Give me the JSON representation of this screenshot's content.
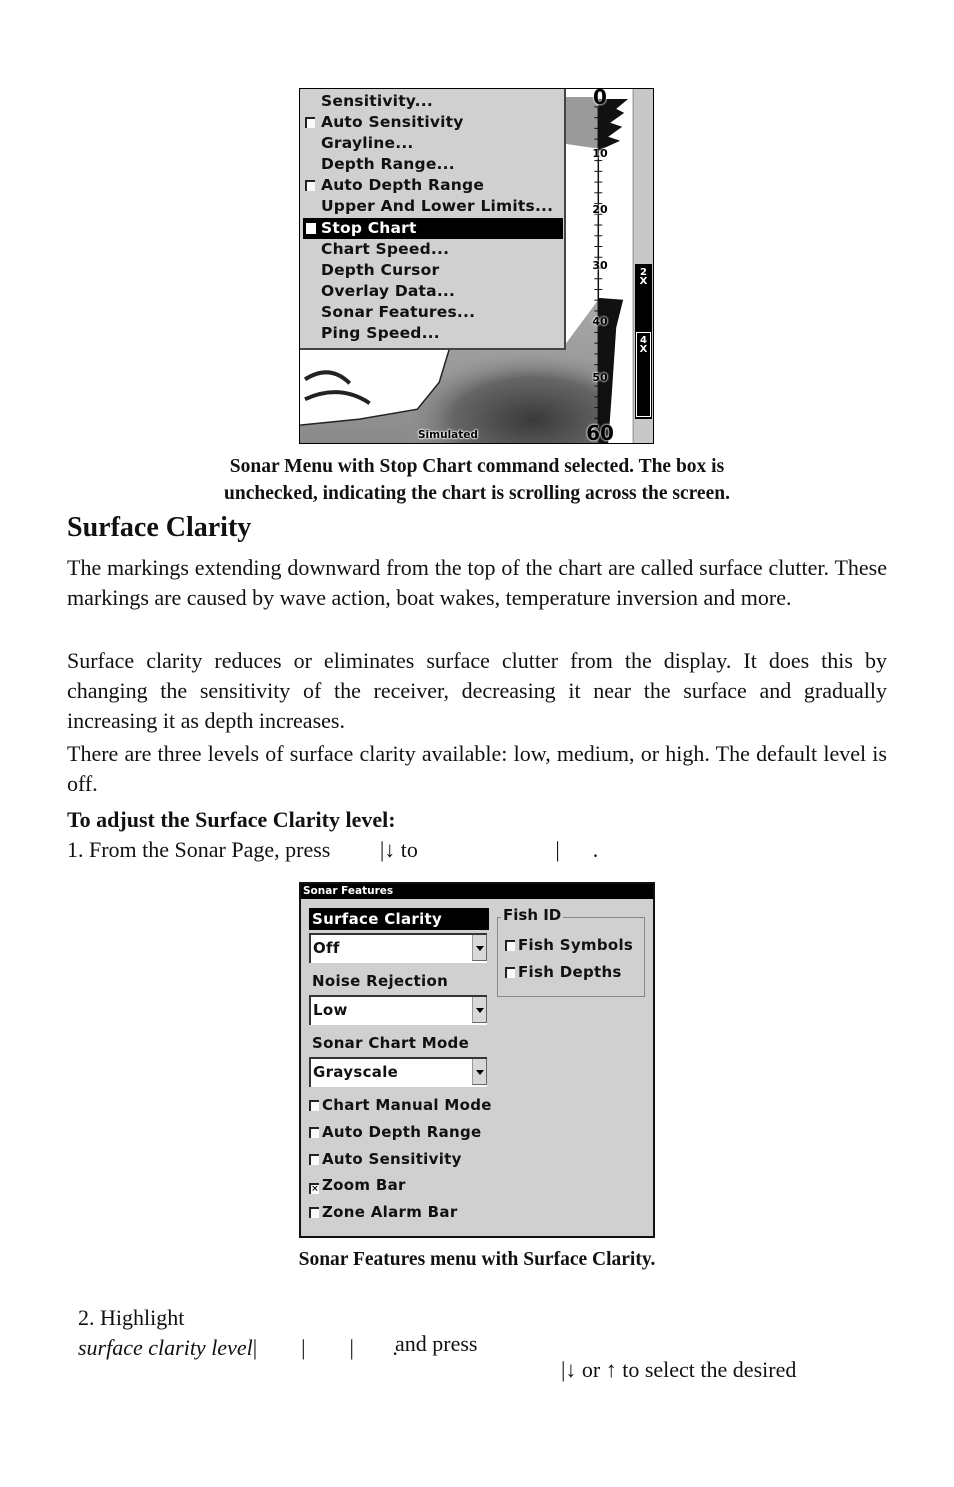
{
  "sonar_menu_screen": {
    "menu_items": [
      {
        "label": "Sensitivity...",
        "checkbox": false,
        "selected": false
      },
      {
        "label": "Auto Sensitivity",
        "checkbox": true,
        "checked": false,
        "selected": false
      },
      {
        "label": "Grayline...",
        "checkbox": false,
        "selected": false
      },
      {
        "label": "Depth Range...",
        "checkbox": false,
        "selected": false
      },
      {
        "label": "Auto Depth Range",
        "checkbox": true,
        "checked": false,
        "selected": false
      },
      {
        "label": "Upper And Lower Limits...",
        "checkbox": false,
        "selected": false
      },
      {
        "label": "Stop Chart",
        "checkbox": true,
        "checked": false,
        "selected": true
      },
      {
        "label": "Chart Speed...",
        "checkbox": false,
        "selected": false
      },
      {
        "label": "Depth Cursor",
        "checkbox": false,
        "selected": false
      },
      {
        "label": "Overlay Data...",
        "checkbox": false,
        "selected": false
      },
      {
        "label": "Sonar Features...",
        "checkbox": false,
        "selected": false
      },
      {
        "label": "Ping Speed...",
        "checkbox": false,
        "selected": false
      }
    ],
    "depth_scale": [
      "0",
      "10",
      "20",
      "30",
      "40",
      "50",
      "60"
    ],
    "zoom_labels": [
      "2X",
      "4X"
    ],
    "simulated_label": "Simulated"
  },
  "caption1_line1": "Sonar Menu with Stop Chart command selected. The box is",
  "caption1_line2": "unchecked, indicating the chart is scrolling across the screen.",
  "heading": "Surface Clarity",
  "para1": "The markings extending downward from the top of the chart are called surface clutter. These markings are caused by wave action, boat wakes, temperature inversion and more.",
  "para2": "Surface clarity reduces or eliminates surface clutter from the display. It does this by changing the sensitivity of the receiver, decreasing it near the surface and gradually increasing it as depth increases.",
  "para3": "There are three levels of surface clarity available: low, medium, or high. The default level is off.",
  "procedure_title": "To adjust the Surface Clarity level:",
  "step1": "1. From the Sonar Page, press         |↓ to                         |      .",
  "sonar_features_screen": {
    "title": "Sonar Features",
    "surface_clarity_label": "Surface Clarity",
    "surface_clarity_value": "Off",
    "noise_rejection_label": "Noise Rejection",
    "noise_rejection_value": "Low",
    "chart_mode_label": "Sonar Chart Mode",
    "chart_mode_value": "Grayscale",
    "fish_id_title": "Fish ID",
    "fish_options": [
      {
        "label": "Fish Symbols",
        "checked": false
      },
      {
        "label": "Fish Depths",
        "checked": false
      }
    ],
    "checkboxes": [
      {
        "label": "Chart Manual Mode",
        "checked": false
      },
      {
        "label": "Auto Depth Range",
        "checked": false
      },
      {
        "label": "Auto Sensitivity",
        "checked": false
      },
      {
        "label": "Zoom Bar",
        "checked": true
      },
      {
        "label": "Zone Alarm Bar",
        "checked": false
      }
    ]
  },
  "caption2": "Sonar Features menu with Surface Clarity.",
  "step2_line1_a": "2. Highlight",
  "step2_line1_b": "and press",
  "step2_line1_c": "|↓ or ↑ to select the desired",
  "step2_line2_italic": "surface clarity level",
  "step2_line2_rest": "|        |        |       ."
}
